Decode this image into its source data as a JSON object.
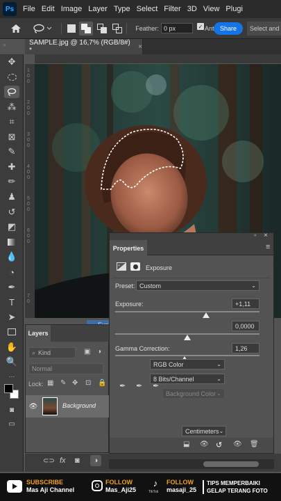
{
  "menubar": {
    "app_badge": "Ps",
    "items": [
      "File",
      "Edit",
      "Image",
      "Layer",
      "Type",
      "Select",
      "Filter",
      "3D",
      "View",
      "Plugi"
    ]
  },
  "options_bar": {
    "feather_label": "Feather:",
    "feather_value": "0 px",
    "antialias_label": "Ant",
    "share_label": "Share",
    "select_mask_label": "Select and M"
  },
  "document_tab": {
    "title": "SAMPLE.jpg @ 16,7% (RGB/8#) *",
    "close": "×"
  },
  "ruler_left_ticks": [
    "1",
    "0",
    "0",
    "2",
    "0",
    "0",
    "3",
    "0",
    "0",
    "4",
    "0",
    "0",
    "5",
    "0",
    "0",
    "6",
    "0",
    "0",
    "7",
    "0"
  ],
  "properties": {
    "tab": "Properties",
    "menu_glyph": "≡",
    "adjustment_name": "Exposure",
    "preset_label": "Preset:",
    "preset_value": "Custom",
    "exposure_label": "Exposure:",
    "exposure_value": "+1,11",
    "offset_value": "0,0000",
    "gamma_label": "Gamma Correction:",
    "gamma_value": "1,26",
    "color_mode": "RGB Color",
    "bit_depth": "8 Bits/Channel",
    "background_color": "Background Color",
    "units": "Centimeters",
    "exposure_level": 0.63,
    "offset_level": 0.5,
    "gamma_level": 0.48
  },
  "layers": {
    "tab": "Layers",
    "kind_label": "Kind",
    "blend_mode": "Normal",
    "lock_label": "Lock:",
    "layer_name": "Background"
  },
  "drag_ghost": "Exposure",
  "footer": {
    "subscribe_title": "SUBSCRIBE",
    "subscribe_name": "Mas Aji Channel",
    "ig_title": "FOLLOW",
    "ig_name": "Mas_Aji25",
    "tiktok_title": "FOLLOW",
    "tiktok_brand": "TikTok",
    "tiktok_name": "masaji_25",
    "tips_line1": "TIPS MEMPERBAIKI",
    "tips_line2": "GELAP TERANG FOTO"
  },
  "colors": {
    "accent": "#1473e6",
    "panel": "#535353",
    "menubar": "#2b2b2b",
    "footer_accent": "#f0a020"
  }
}
